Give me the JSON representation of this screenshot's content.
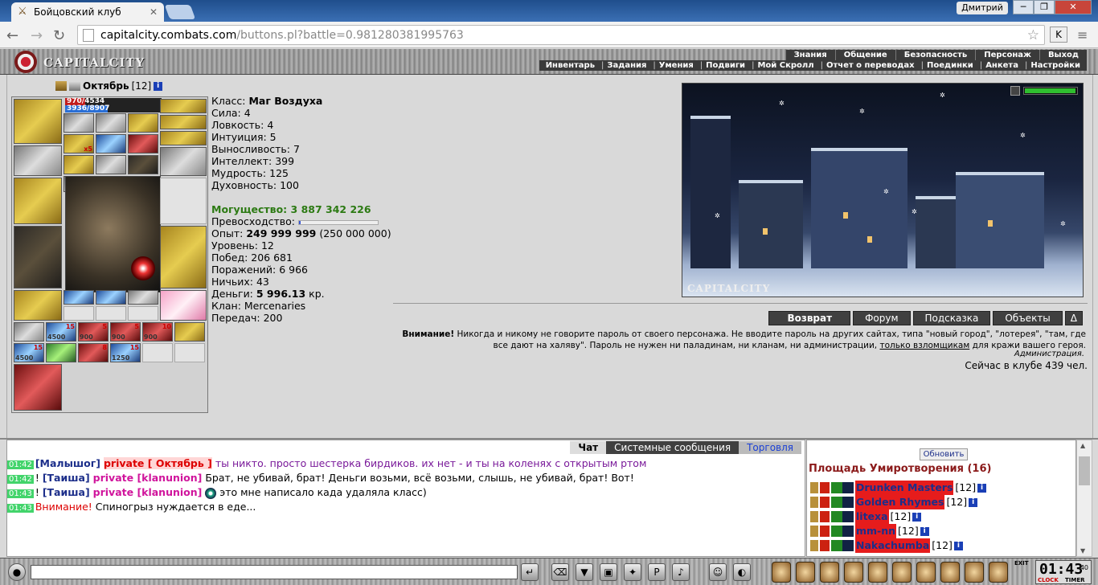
{
  "browser": {
    "tab_title": "Бойцовский клуб",
    "user": "Дмитрий",
    "url_host": "capitalcity.combats.com",
    "url_path": "/buttons.pl?battle=0.981280381995763",
    "ext_label": "K"
  },
  "header": {
    "logo": "CAPITALCITY",
    "menu_top": [
      "Знания",
      "Общение",
      "Безопасность",
      "Персонаж",
      "Выход"
    ],
    "menu_bottom": [
      "Инвентарь",
      "Задания",
      "Умения",
      "Подвиги",
      "Мой Скролл",
      "Отчет о переводах",
      "Поединки",
      "Анкета",
      "Настройки"
    ]
  },
  "character": {
    "name": "Октябрь",
    "level": "[12]",
    "hp": "970/4534",
    "hp_fraction": 0.21,
    "mana": "3936/8907",
    "mana_fraction": 0.44,
    "stats": [
      {
        "label": "Класс: ",
        "value": "Маг Воздуха"
      },
      {
        "label": "Сила: ",
        "value": "4"
      },
      {
        "label": "Ловкость: ",
        "value": "4"
      },
      {
        "label": "Интуиция: ",
        "value": "5"
      },
      {
        "label": "Выносливость: ",
        "value": "7"
      },
      {
        "label": "Интеллект: ",
        "value": "399"
      },
      {
        "label": "Мудрость: ",
        "value": "125"
      },
      {
        "label": "Духовность: ",
        "value": "100"
      }
    ],
    "power_label": "Могущество: ",
    "power_value": "3 887 342 226",
    "superiority_label": "Превосходство: ",
    "superiority_fraction": 0.02,
    "exp_label": "Опыт: ",
    "exp_value": "249 999 999",
    "exp_next": " (250 000 000)",
    "level_label": "Уровень: 12",
    "wins": "Побед: 206 681",
    "losses": "Поражений: 6 966",
    "draws": "Ничьих: 43",
    "money_label": "Деньги: ",
    "money_value": "5 996.13",
    "money_unit": " кр.",
    "clan": "Клан: Mercenaries",
    "transfers": "Передач: 200",
    "slot_badges": [
      "x5",
      "15",
      "5",
      "5",
      "10",
      "15",
      "8",
      "15"
    ],
    "slot_values": [
      "4500",
      "900",
      "900",
      "900",
      "4500",
      "1250"
    ]
  },
  "location": {
    "caption": "CAPITALCITY",
    "health_fraction": 0.95
  },
  "actions": {
    "buttons": [
      "Возврат",
      "Форум",
      "Подсказка",
      "Объекты",
      "Δ"
    ]
  },
  "warning": {
    "bold": "Внимание!",
    "text1": " Никогда и никому не говорите пароль от своего персонажа. Не вводите пароль на других сайтах, типа \"новый город\", \"лотерея\", \"там, где все дают на халяву\". Пароль не нужен ни паладинам, ни кланам, ни администрации, ",
    "link": "только взломщикам",
    "text2": " для кражи вашего героя.",
    "admin": "Администрация.",
    "online": "Сейчас в клубе 439 чел."
  },
  "chat": {
    "tabs": [
      "Чат",
      "Системные сообщения",
      "Торговля"
    ],
    "messages": [
      {
        "time": "01:42",
        "nick": "[Малышог]",
        "priv": "private [ Октябрь ]",
        "text": " ты никто. просто шестерка бирдиков. их нет - и ты на коленях с открытым ртом"
      },
      {
        "time": "01:42",
        "prefix": "! ",
        "nick": "[Таиша]",
        "priv": "private [klanunion]",
        "text": " Брат, не убивай, брат! Деньги возьми, всё возьми, слышь, не убивай, брат! Вот!"
      },
      {
        "time": "01:43",
        "prefix": "! ",
        "nick": "[Таиша]",
        "priv": "private [klanunion]",
        "text": " это мне написало када удаляла класс)"
      },
      {
        "time": "01:43",
        "sys": "Внимание!",
        "text": " Спиногрыз нуждается в еде..."
      }
    ]
  },
  "room": {
    "refresh": "Обновить",
    "title": "Площадь Умиротворения (16)",
    "players": [
      {
        "name": "Drunken Masters",
        "level": "[12]"
      },
      {
        "name": "Golden Rhymes",
        "level": "[12]"
      },
      {
        "name": "litexa",
        "level": "[12]"
      },
      {
        "name": "mm-nn",
        "level": "[12]"
      },
      {
        "name": "Nakachumba",
        "level": "[12]"
      }
    ]
  },
  "footer": {
    "exit": "EXIT",
    "time": "01:43",
    "seconds": "40",
    "clock_label": "CLOCK",
    "timer_label": "TIMER"
  }
}
